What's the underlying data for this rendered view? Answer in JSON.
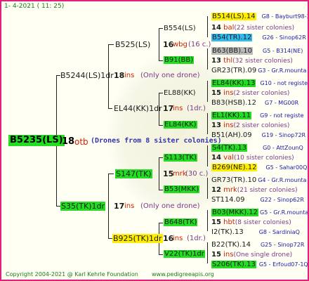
{
  "header": {
    "date": "1- 4-2021 ( 11: 25)"
  },
  "root": {
    "name": "B5235(LS)",
    "num": "18",
    "code": "otb",
    "note": "(Drones from 8 sister colonies)"
  },
  "g1": {
    "top": {
      "name": "B5244(LS)1dr",
      "num": "18",
      "code": "ins",
      "note": "(Only one drone)"
    },
    "bot": {
      "name": "S35(TK)1dr",
      "num": "17",
      "code": "ins",
      "note": "(Only one drone)"
    }
  },
  "g2": {
    "a": {
      "name": "B525(LS)",
      "num": "16",
      "code": "wbg",
      "note": "(16 c.)"
    },
    "b": {
      "name": "EL44(KK)1dr",
      "num": "17",
      "code": "ins",
      "note": "(1dr.)"
    },
    "c": {
      "name": "S147(TK)",
      "num": "15",
      "code": "mrk",
      "note": "(30 c.)"
    },
    "d": {
      "name": "B925(TK)1dr",
      "num": "16",
      "code": "ins",
      "note": "(1dr.)"
    }
  },
  "g3": [
    {
      "name": "B554(LS)"
    },
    {
      "name": "B91(BB)"
    },
    {
      "name": "EL88(KK)"
    },
    {
      "name": "EL84(KK)"
    },
    {
      "name": "S113(TK)"
    },
    {
      "name": "B53(MKK)"
    },
    {
      "name": "B648(TK)"
    },
    {
      "name": "V22(TK)1dr"
    }
  ],
  "g4": [
    {
      "name": "B514(LS).14",
      "info": "G8 - Bayburt98-3"
    },
    {
      "mid": "14",
      "code": "bal",
      "note": "(22 sister colonies)"
    },
    {
      "name": "B54(TR).12",
      "info": "G26 - Sinop62R"
    },
    {
      "name": "B63(BB).10",
      "info": "G5 - B314(NE)"
    },
    {
      "mid": "13",
      "code": "thl",
      "note": "(32 sister colonies)"
    },
    {
      "name": "GR23(TR).09",
      "info": "G3 - Gr.R.mounta"
    },
    {
      "name": "EL84(KK).13",
      "info": "G10 - not registe"
    },
    {
      "mid": "15",
      "code": "ins",
      "note": "(2 sister colonies)"
    },
    {
      "name": "B83(HSB).12",
      "info": "G7 - MG00R"
    },
    {
      "name": "EL1(KK).11",
      "info": "G9 - not registe"
    },
    {
      "mid": "13",
      "code": "ins",
      "note": "(2 sister colonies)"
    },
    {
      "name": "B51(AH).09",
      "info": "G19 - Sinop72R"
    },
    {
      "name": "S4(TK).13",
      "info": "G0 - AttZounQ"
    },
    {
      "mid": "14",
      "code": "val",
      "note": "(10 sister colonies)"
    },
    {
      "name": "B269(NE).12",
      "info": "G5 - Sahar00Q"
    },
    {
      "name": "GR73(TR).10",
      "info": "G4 - Gr.R.mounta"
    },
    {
      "mid": "12",
      "code": "mrk",
      "note": "(21 sister colonies)"
    },
    {
      "name": "ST114.09",
      "info": "G22 - Sinop62R"
    },
    {
      "name": "B03(MKK).12",
      "info": "G5 - Gr.R.mounta"
    },
    {
      "mid": "15",
      "code": "hbt",
      "note": "(8 sister colonies)"
    },
    {
      "name": "I2(TK).13",
      "info": "G8 - SardiniaQ"
    },
    {
      "name": "B22(TK).14",
      "info": "G25 - Sinop72R"
    },
    {
      "mid": "15",
      "code": "ins",
      "note": "(One single drone)"
    },
    {
      "name": "S206(TK).13",
      "info": "G5 - Erfoud07-1Q"
    }
  ],
  "footer": {
    "copyright": "Copyright 2004-2021 @ Karl Kehrle Foundation",
    "site": "www.pedigreeapis.org"
  },
  "colors": {
    "border": "#e0207a",
    "green": "#22dd22",
    "yellow": "#ffee00",
    "cyan": "#33bbee",
    "grey": "#bbbbbb",
    "red": "#cc2200",
    "purple": "#7a3b8a"
  }
}
